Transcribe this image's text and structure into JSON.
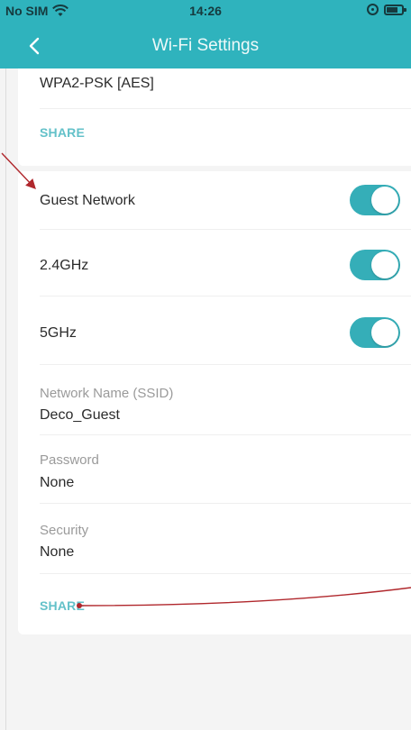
{
  "status_bar": {
    "carrier": "No SIM",
    "time": "14:26",
    "wifi_icon": "wifi-icon",
    "orientation_lock_icon": "lock-rotation-icon",
    "battery_icon": "battery-icon"
  },
  "nav": {
    "title": "Wi-Fi Settings",
    "back_icon": "chevron-left-icon"
  },
  "top_card": {
    "security_value": "WPA2-PSK [AES]",
    "share_label": "SHARE"
  },
  "guest_card": {
    "toggles": [
      {
        "label": "Guest Network",
        "on": true
      },
      {
        "label": "2.4GHz",
        "on": true
      },
      {
        "label": "5GHz",
        "on": true
      }
    ],
    "fields": [
      {
        "label": "Network Name (SSID)",
        "value": "Deco_Guest"
      },
      {
        "label": "Password",
        "value": "None"
      },
      {
        "label": "Security",
        "value": "None"
      }
    ],
    "share_label": "SHARE"
  },
  "colors": {
    "header": "#2fb3bd",
    "toggle_on": "#35aeb8",
    "share_link": "#63c1c9",
    "annotation_arrow": "#b0272c"
  }
}
